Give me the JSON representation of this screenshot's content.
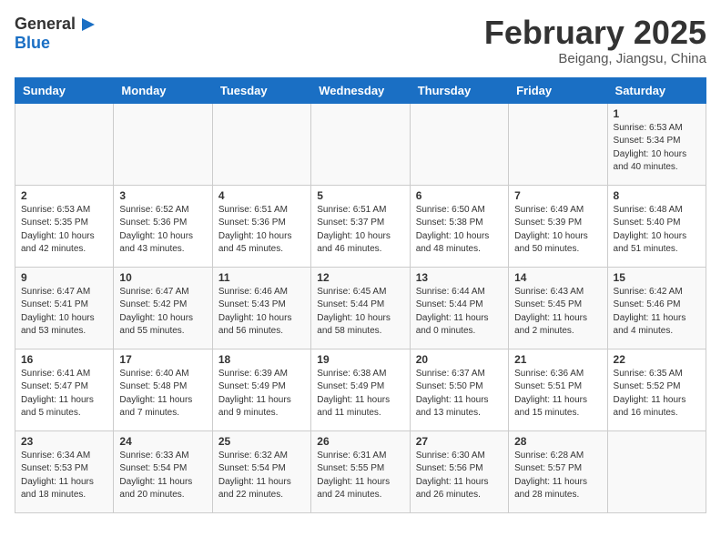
{
  "header": {
    "logo_general": "General",
    "logo_blue": "Blue",
    "month_title": "February 2025",
    "location": "Beigang, Jiangsu, China"
  },
  "weekdays": [
    "Sunday",
    "Monday",
    "Tuesday",
    "Wednesday",
    "Thursday",
    "Friday",
    "Saturday"
  ],
  "weeks": [
    [
      {
        "day": "",
        "info": ""
      },
      {
        "day": "",
        "info": ""
      },
      {
        "day": "",
        "info": ""
      },
      {
        "day": "",
        "info": ""
      },
      {
        "day": "",
        "info": ""
      },
      {
        "day": "",
        "info": ""
      },
      {
        "day": "1",
        "info": "Sunrise: 6:53 AM\nSunset: 5:34 PM\nDaylight: 10 hours\nand 40 minutes."
      }
    ],
    [
      {
        "day": "2",
        "info": "Sunrise: 6:53 AM\nSunset: 5:35 PM\nDaylight: 10 hours\nand 42 minutes."
      },
      {
        "day": "3",
        "info": "Sunrise: 6:52 AM\nSunset: 5:36 PM\nDaylight: 10 hours\nand 43 minutes."
      },
      {
        "day": "4",
        "info": "Sunrise: 6:51 AM\nSunset: 5:36 PM\nDaylight: 10 hours\nand 45 minutes."
      },
      {
        "day": "5",
        "info": "Sunrise: 6:51 AM\nSunset: 5:37 PM\nDaylight: 10 hours\nand 46 minutes."
      },
      {
        "day": "6",
        "info": "Sunrise: 6:50 AM\nSunset: 5:38 PM\nDaylight: 10 hours\nand 48 minutes."
      },
      {
        "day": "7",
        "info": "Sunrise: 6:49 AM\nSunset: 5:39 PM\nDaylight: 10 hours\nand 50 minutes."
      },
      {
        "day": "8",
        "info": "Sunrise: 6:48 AM\nSunset: 5:40 PM\nDaylight: 10 hours\nand 51 minutes."
      }
    ],
    [
      {
        "day": "9",
        "info": "Sunrise: 6:47 AM\nSunset: 5:41 PM\nDaylight: 10 hours\nand 53 minutes."
      },
      {
        "day": "10",
        "info": "Sunrise: 6:47 AM\nSunset: 5:42 PM\nDaylight: 10 hours\nand 55 minutes."
      },
      {
        "day": "11",
        "info": "Sunrise: 6:46 AM\nSunset: 5:43 PM\nDaylight: 10 hours\nand 56 minutes."
      },
      {
        "day": "12",
        "info": "Sunrise: 6:45 AM\nSunset: 5:44 PM\nDaylight: 10 hours\nand 58 minutes."
      },
      {
        "day": "13",
        "info": "Sunrise: 6:44 AM\nSunset: 5:44 PM\nDaylight: 11 hours\nand 0 minutes."
      },
      {
        "day": "14",
        "info": "Sunrise: 6:43 AM\nSunset: 5:45 PM\nDaylight: 11 hours\nand 2 minutes."
      },
      {
        "day": "15",
        "info": "Sunrise: 6:42 AM\nSunset: 5:46 PM\nDaylight: 11 hours\nand 4 minutes."
      }
    ],
    [
      {
        "day": "16",
        "info": "Sunrise: 6:41 AM\nSunset: 5:47 PM\nDaylight: 11 hours\nand 5 minutes."
      },
      {
        "day": "17",
        "info": "Sunrise: 6:40 AM\nSunset: 5:48 PM\nDaylight: 11 hours\nand 7 minutes."
      },
      {
        "day": "18",
        "info": "Sunrise: 6:39 AM\nSunset: 5:49 PM\nDaylight: 11 hours\nand 9 minutes."
      },
      {
        "day": "19",
        "info": "Sunrise: 6:38 AM\nSunset: 5:49 PM\nDaylight: 11 hours\nand 11 minutes."
      },
      {
        "day": "20",
        "info": "Sunrise: 6:37 AM\nSunset: 5:50 PM\nDaylight: 11 hours\nand 13 minutes."
      },
      {
        "day": "21",
        "info": "Sunrise: 6:36 AM\nSunset: 5:51 PM\nDaylight: 11 hours\nand 15 minutes."
      },
      {
        "day": "22",
        "info": "Sunrise: 6:35 AM\nSunset: 5:52 PM\nDaylight: 11 hours\nand 16 minutes."
      }
    ],
    [
      {
        "day": "23",
        "info": "Sunrise: 6:34 AM\nSunset: 5:53 PM\nDaylight: 11 hours\nand 18 minutes."
      },
      {
        "day": "24",
        "info": "Sunrise: 6:33 AM\nSunset: 5:54 PM\nDaylight: 11 hours\nand 20 minutes."
      },
      {
        "day": "25",
        "info": "Sunrise: 6:32 AM\nSunset: 5:54 PM\nDaylight: 11 hours\nand 22 minutes."
      },
      {
        "day": "26",
        "info": "Sunrise: 6:31 AM\nSunset: 5:55 PM\nDaylight: 11 hours\nand 24 minutes."
      },
      {
        "day": "27",
        "info": "Sunrise: 6:30 AM\nSunset: 5:56 PM\nDaylight: 11 hours\nand 26 minutes."
      },
      {
        "day": "28",
        "info": "Sunrise: 6:28 AM\nSunset: 5:57 PM\nDaylight: 11 hours\nand 28 minutes."
      },
      {
        "day": "",
        "info": ""
      }
    ]
  ]
}
